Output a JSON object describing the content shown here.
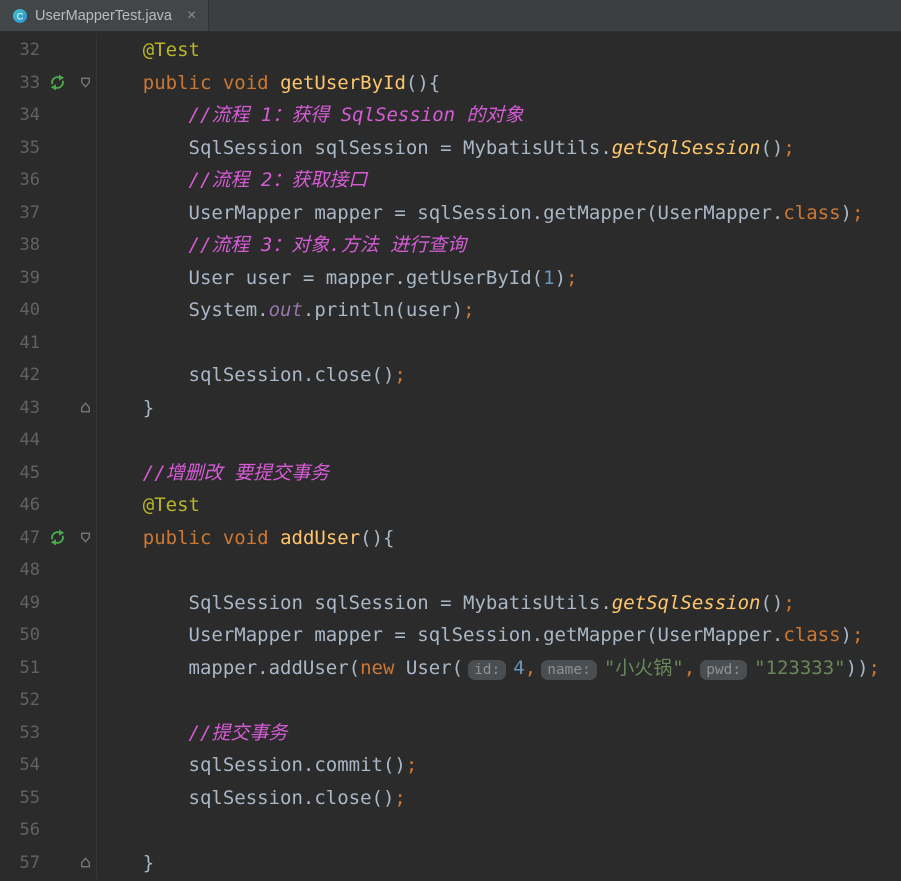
{
  "tab": {
    "title": "UserMapperTest.java",
    "close_label": "×",
    "icon": "java-class-icon",
    "icon_letter": "C"
  },
  "colors": {
    "editor_background": "#2b2b2b",
    "tabbar_background": "#3c3f41",
    "keyword": "#cc7832",
    "annotation": "#bbb529",
    "method_declaration": "#ffc66b",
    "comment": "#d65cd6",
    "number": "#6897bb",
    "string": "#6a8759",
    "plain_text": "#a9b7c6",
    "line_number": "#606366",
    "run_icon_green": "#4aa84a"
  },
  "icons": {
    "gutter_run": "run-test-icon",
    "fold_start": "fold-start-icon",
    "fold_end": "fold-end-icon",
    "tab_close": "close-icon"
  },
  "editor": {
    "lines": [
      {
        "n": 32,
        "tokens": [
          [
            "    ",
            "pl"
          ],
          [
            "@Test",
            "an"
          ]
        ]
      },
      {
        "n": 33,
        "run": true,
        "fold": "start",
        "tokens": [
          [
            "    ",
            "pl"
          ],
          [
            "public",
            "kw"
          ],
          [
            " ",
            "pl"
          ],
          [
            "void",
            "kw"
          ],
          [
            " ",
            "pl"
          ],
          [
            "getUserById",
            "md"
          ],
          [
            "(){",
            "pl"
          ]
        ]
      },
      {
        "n": 34,
        "tokens": [
          [
            "        ",
            "pl"
          ],
          [
            "//流程 1：获得 SqlSession 的对象",
            "cm"
          ]
        ]
      },
      {
        "n": 35,
        "tokens": [
          [
            "        SqlSession sqlSession = MybatisUtils.",
            "pl"
          ],
          [
            "getSqlSession",
            "sm"
          ],
          [
            "()",
            "pl"
          ],
          [
            ";",
            "pu"
          ]
        ]
      },
      {
        "n": 36,
        "tokens": [
          [
            "        ",
            "pl"
          ],
          [
            "//流程 2：获取接口",
            "cm"
          ]
        ]
      },
      {
        "n": 37,
        "tokens": [
          [
            "        UserMapper mapper = sqlSession.getMapper(UserMapper.",
            "pl"
          ],
          [
            "class",
            "kw"
          ],
          [
            ")",
            "pl"
          ],
          [
            ";",
            "pu"
          ]
        ]
      },
      {
        "n": 38,
        "tokens": [
          [
            "        ",
            "pl"
          ],
          [
            "//流程 3：对象.方法 进行查询",
            "cm"
          ]
        ]
      },
      {
        "n": 39,
        "tokens": [
          [
            "        User user = mapper.getUserById(",
            "pl"
          ],
          [
            "1",
            "nm"
          ],
          [
            ")",
            "pl"
          ],
          [
            ";",
            "pu"
          ]
        ]
      },
      {
        "n": 40,
        "tokens": [
          [
            "        System.",
            "pl"
          ],
          [
            "out",
            "fd"
          ],
          [
            ".println(user)",
            "pl"
          ],
          [
            ";",
            "pu"
          ]
        ]
      },
      {
        "n": 41,
        "tokens": []
      },
      {
        "n": 42,
        "tokens": [
          [
            "        sqlSession.close()",
            "pl"
          ],
          [
            ";",
            "pu"
          ]
        ]
      },
      {
        "n": 43,
        "fold": "end",
        "tokens": [
          [
            "    }",
            "pl"
          ]
        ]
      },
      {
        "n": 44,
        "tokens": []
      },
      {
        "n": 45,
        "tokens": [
          [
            "    ",
            "pl"
          ],
          [
            "//增删改 要提交事务",
            "cm"
          ]
        ]
      },
      {
        "n": 46,
        "tokens": [
          [
            "    ",
            "pl"
          ],
          [
            "@Test",
            "an"
          ]
        ]
      },
      {
        "n": 47,
        "run": true,
        "fold": "start",
        "tokens": [
          [
            "    ",
            "pl"
          ],
          [
            "public",
            "kw"
          ],
          [
            " ",
            "pl"
          ],
          [
            "void",
            "kw"
          ],
          [
            " ",
            "pl"
          ],
          [
            "addUser",
            "md"
          ],
          [
            "(){",
            "pl"
          ]
        ]
      },
      {
        "n": 48,
        "tokens": []
      },
      {
        "n": 49,
        "tokens": [
          [
            "        SqlSession sqlSession = MybatisUtils.",
            "pl"
          ],
          [
            "getSqlSession",
            "sm"
          ],
          [
            "()",
            "pl"
          ],
          [
            ";",
            "pu"
          ]
        ]
      },
      {
        "n": 50,
        "tokens": [
          [
            "        UserMapper mapper = sqlSession.getMapper(UserMapper.",
            "pl"
          ],
          [
            "class",
            "kw"
          ],
          [
            ")",
            "pl"
          ],
          [
            ";",
            "pu"
          ]
        ]
      },
      {
        "n": 51,
        "tokens": [
          [
            "        mapper.addUser(",
            "pl"
          ],
          [
            "new",
            "kw"
          ],
          [
            " User(",
            "pl"
          ],
          [
            "id:",
            "hi"
          ],
          [
            "4",
            "nm"
          ],
          [
            ",",
            "pu"
          ],
          [
            "name:",
            "hi"
          ],
          [
            "\"小火锅\"",
            "st"
          ],
          [
            ",",
            "pu"
          ],
          [
            "pwd:",
            "hi"
          ],
          [
            "\"123333\"",
            "st"
          ],
          [
            "))",
            "pl"
          ],
          [
            ";",
            "pu"
          ]
        ]
      },
      {
        "n": 52,
        "tokens": []
      },
      {
        "n": 53,
        "tokens": [
          [
            "        ",
            "pl"
          ],
          [
            "//提交事务",
            "cm"
          ]
        ]
      },
      {
        "n": 54,
        "tokens": [
          [
            "        sqlSession.commit()",
            "pl"
          ],
          [
            ";",
            "pu"
          ]
        ]
      },
      {
        "n": 55,
        "tokens": [
          [
            "        sqlSession.close()",
            "pl"
          ],
          [
            ";",
            "pu"
          ]
        ]
      },
      {
        "n": 56,
        "tokens": []
      },
      {
        "n": 57,
        "fold": "end",
        "tokens": [
          [
            "    }",
            "pl"
          ]
        ]
      }
    ]
  }
}
